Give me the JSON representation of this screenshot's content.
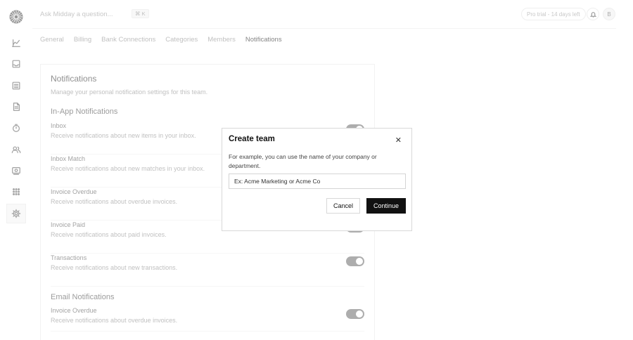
{
  "header": {
    "search_placeholder": "Ask Midday a question...",
    "search_shortcut": "⌘ K",
    "trial_badge": "Pro trial - 14 days left",
    "avatar_initial": "B"
  },
  "sidebar": {
    "items": [
      {
        "icon": "chart-icon"
      },
      {
        "icon": "inbox-icon"
      },
      {
        "icon": "transactions-icon"
      },
      {
        "icon": "invoice-icon"
      },
      {
        "icon": "timer-icon"
      },
      {
        "icon": "customers-icon"
      },
      {
        "icon": "vault-icon"
      },
      {
        "icon": "apps-icon"
      },
      {
        "icon": "settings-icon",
        "active": true
      }
    ]
  },
  "tabs": [
    "General",
    "Billing",
    "Bank Connections",
    "Categories",
    "Members",
    "Notifications"
  ],
  "active_tab": "Notifications",
  "card": {
    "title": "Notifications",
    "description": "Manage your personal notification settings for this team.",
    "in_app_title": "In-App Notifications",
    "in_app": [
      {
        "title": "Inbox",
        "description": "Receive notifications about new items in your inbox.",
        "enabled": true
      },
      {
        "title": "Inbox Match",
        "description": "Receive notifications about new matches in your inbox.",
        "enabled": true
      },
      {
        "title": "Invoice Overdue",
        "description": "Receive notifications about overdue invoices.",
        "enabled": true
      },
      {
        "title": "Invoice Paid",
        "description": "Receive notifications about paid invoices.",
        "enabled": true
      },
      {
        "title": "Transactions",
        "description": "Receive notifications about new transactions.",
        "enabled": true
      }
    ],
    "email_title": "Email Notifications",
    "email": [
      {
        "title": "Invoice Overdue",
        "description": "Receive notifications about overdue invoices.",
        "enabled": true
      }
    ]
  },
  "modal": {
    "title": "Create team",
    "close_glyph": "✕",
    "description": "For example, you can use the name of your company or department.",
    "input_placeholder": "Ex: Acme Marketing or Acme Co",
    "cancel_label": "Cancel",
    "continue_label": "Continue"
  }
}
